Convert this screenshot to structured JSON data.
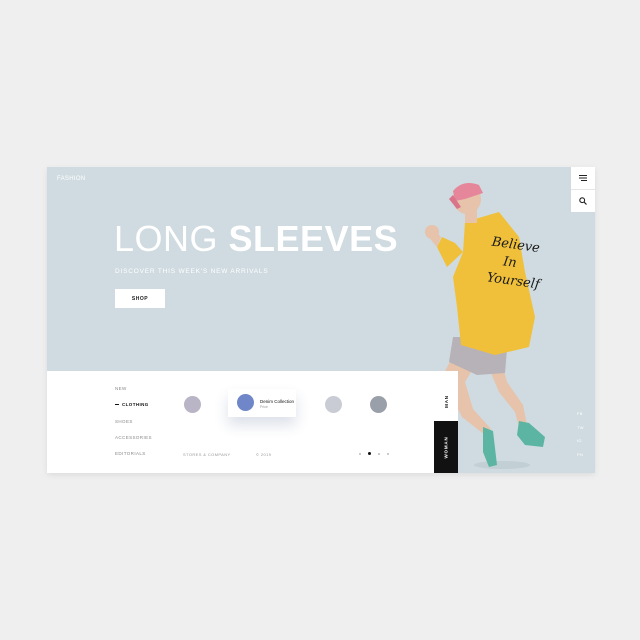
{
  "brand": "FASHION",
  "hero": {
    "title_light": "LONG",
    "title_bold": "SLEEVES",
    "subtitle": "DISCOVER THIS WEEK'S NEW ARRIVALS",
    "shop_label": "SHOP",
    "script_lines": [
      "Believe",
      "In",
      "Yourself"
    ]
  },
  "header_icons": [
    "menu-icon",
    "search-icon"
  ],
  "nav": {
    "items": [
      "NEW",
      "CLOTHING",
      "SHOES",
      "ACCESSORIES",
      "EDITORIALS"
    ],
    "active": "CLOTHING"
  },
  "collections": [
    {
      "avatar": "avatar-1",
      "color": "#b9b4c6"
    },
    {
      "avatar": "avatar-2",
      "color": "#6f87c8",
      "title": "Denim Collection",
      "subtitle": "Price"
    },
    {
      "avatar": "avatar-3",
      "color": "#c9ccd4"
    },
    {
      "avatar": "avatar-4",
      "color": "#9aa0aa"
    }
  ],
  "footer": {
    "company": "STORES & COMPANY",
    "copyright": "© 2019"
  },
  "pagination": {
    "total": 4,
    "active": 2
  },
  "gender": {
    "man": "MAN",
    "woman": "WOMAN"
  },
  "social": [
    "FB",
    "TW",
    "IG",
    "PN"
  ],
  "colors": {
    "hero_bg": "#cfdbe0",
    "accent": "#f0c03a",
    "cap": "#e6869a",
    "dark": "#111111"
  }
}
